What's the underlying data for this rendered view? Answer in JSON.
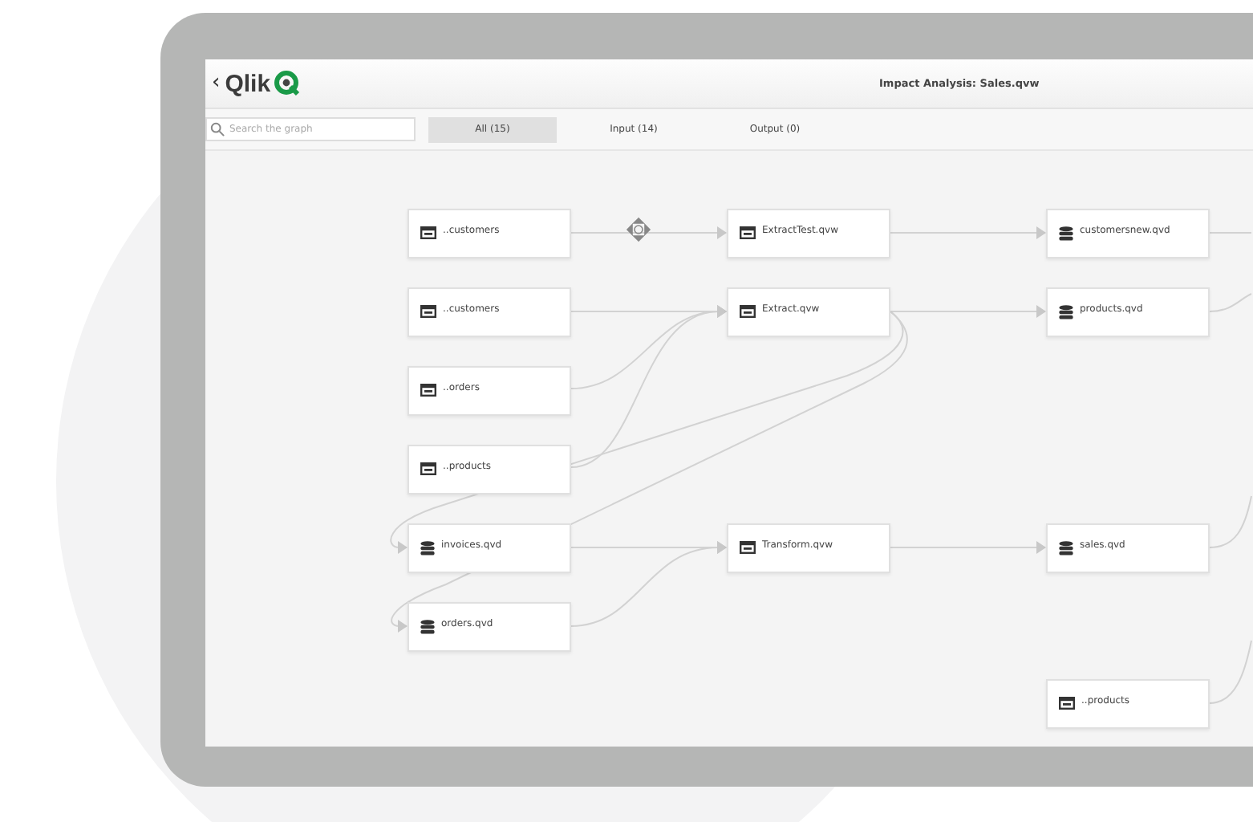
{
  "header": {
    "back": "‹",
    "logo": "Qlik",
    "title": "Impact Analysis: Sales.qvw"
  },
  "search": {
    "placeholder": "Search the graph"
  },
  "tabs": [
    {
      "label": "All (15)",
      "selected": true
    },
    {
      "label": "Input (14)",
      "selected": false
    },
    {
      "label": "Output (0)",
      "selected": false
    }
  ],
  "nodes": [
    {
      "kind": "app",
      "label": "..customers"
    },
    {
      "kind": "app",
      "label": "..customers"
    },
    {
      "kind": "app",
      "label": "..orders"
    },
    {
      "kind": "app",
      "label": "..products"
    },
    {
      "kind": "qvd",
      "label": "invoices.qvd"
    },
    {
      "kind": "qvd",
      "label": "orders.qvd"
    },
    {
      "kind": "app",
      "label": "ExtractTest.qvw"
    },
    {
      "kind": "app",
      "label": "Extract.qvw"
    },
    {
      "kind": "app",
      "label": "Transform.qvw"
    },
    {
      "kind": "qvd",
      "label": "customersnew.qvd"
    },
    {
      "kind": "qvd",
      "label": "products.qvd"
    },
    {
      "kind": "qvd",
      "label": "sales.qvd"
    },
    {
      "kind": "app",
      "label": "..products"
    }
  ]
}
